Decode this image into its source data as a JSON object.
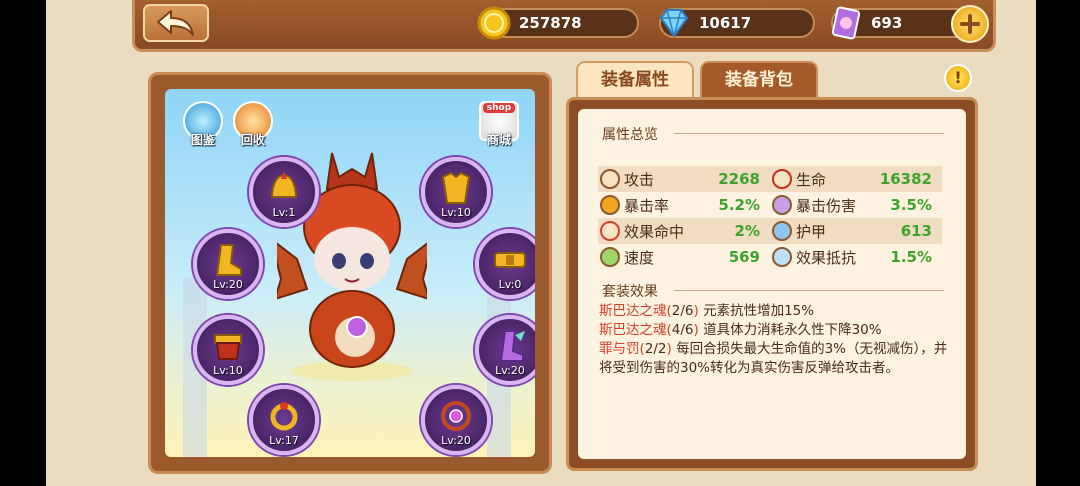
{
  "resources": {
    "gold": "257878",
    "diamonds": "10617",
    "tickets": "693"
  },
  "scene": {
    "codex_label": "图鉴",
    "recycle_label": "回收",
    "shop_label": "商城",
    "shop_sign": "shop"
  },
  "equipment": {
    "helmet_level": "Lv:1",
    "armor_level": "Lv:10",
    "boots_level": "Lv:20",
    "belt_level": "Lv:0",
    "waist_level": "Lv:10",
    "shoes_level": "Lv:20",
    "ring_level": "Lv:17",
    "amulet_level": "Lv:20"
  },
  "tabs": {
    "attributes": "装备属性",
    "backpack": "装备背包"
  },
  "warning_mark": "!",
  "overview": {
    "title": "属性总览",
    "rows": [
      {
        "left_name": "攻击",
        "left_value": "2268",
        "right_name": "生命",
        "right_value": "16382"
      },
      {
        "left_name": "暴击率",
        "left_value": "5.2%",
        "right_name": "暴击伤害",
        "right_value": "3.5%"
      },
      {
        "left_name": "效果命中",
        "left_value": "2%",
        "right_name": "护甲",
        "right_value": "613"
      },
      {
        "left_name": "速度",
        "left_value": "569",
        "right_name": "效果抵抗",
        "right_value": "1.5%"
      }
    ]
  },
  "set_effects": {
    "title": "套装效果",
    "items": [
      {
        "set": "斯巴达之魂(",
        "count": "2/6",
        "close": ")",
        "desc": "元素抗性增加15%"
      },
      {
        "set": "斯巴达之魂(",
        "count": "4/6",
        "close": ")",
        "desc": "道具体力消耗永久性下降30%"
      },
      {
        "set": "罪与罚(",
        "count": "2/2",
        "close": ")",
        "desc": "每回合损失最大生命值的3%（无视减伤），并将受到伤害的30%转化为真实伤害反弹给攻击者。"
      }
    ]
  },
  "colors": {
    "value_green": "#3da32c",
    "set_red": "#d8402a",
    "frame_brown": "#8c4d24"
  }
}
